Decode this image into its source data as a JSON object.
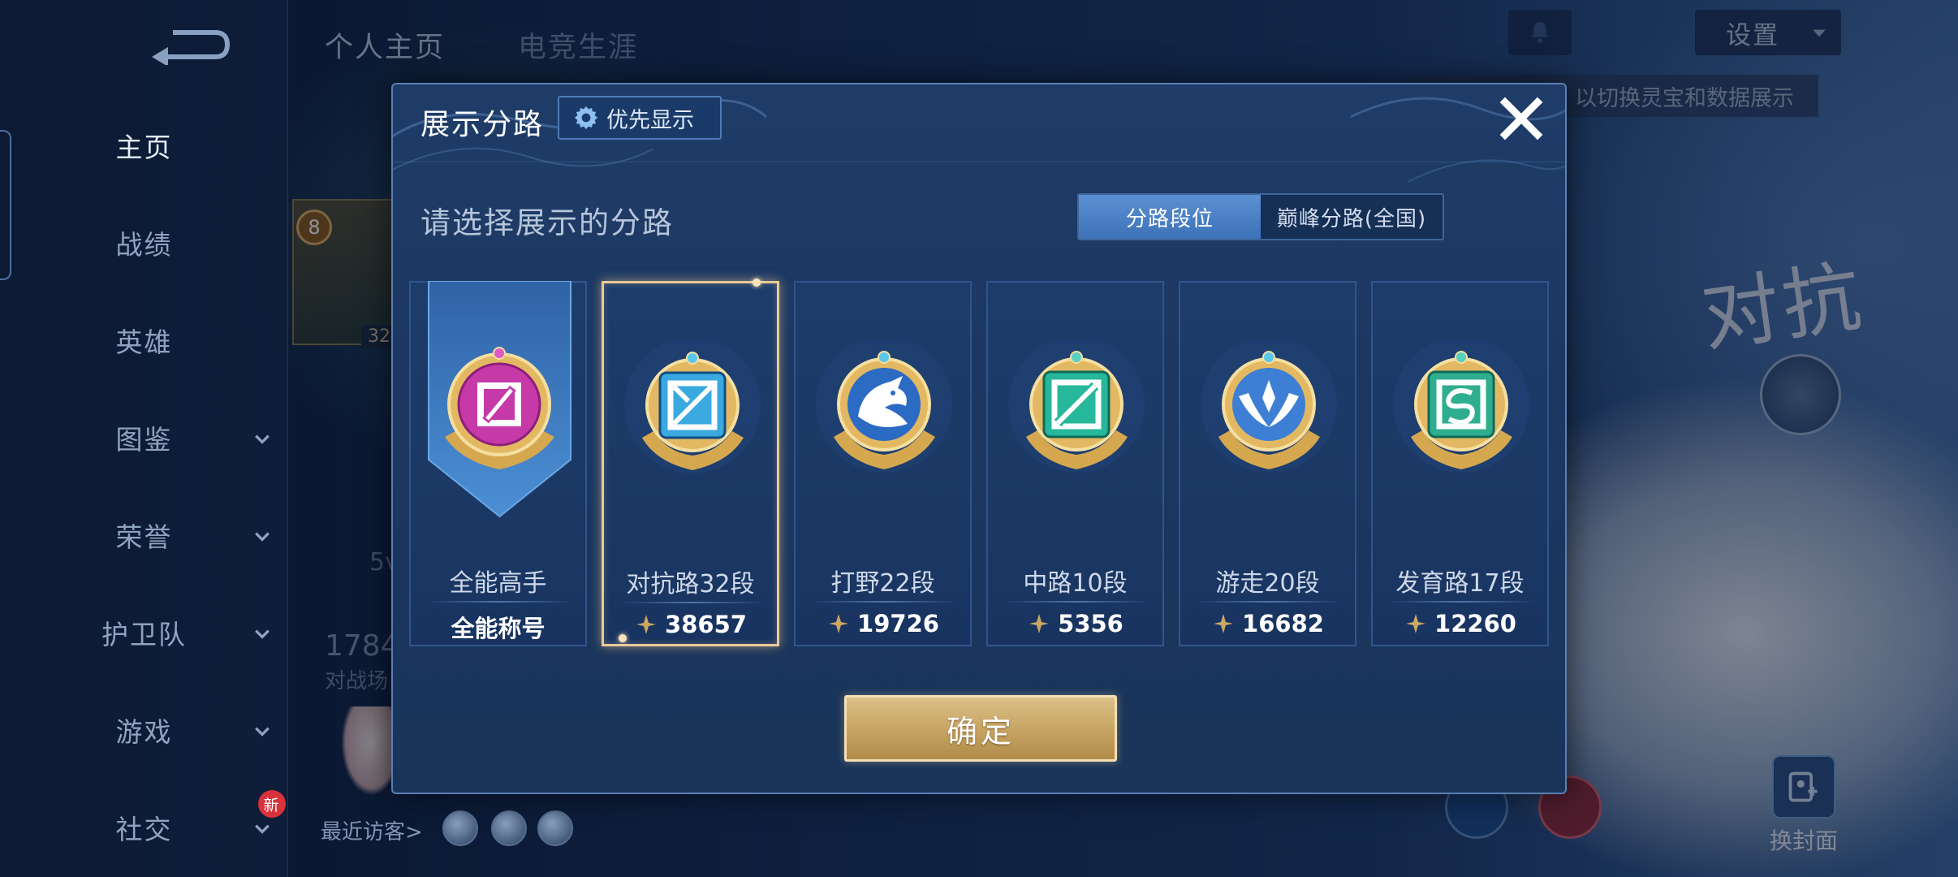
{
  "sidebar": {
    "items": [
      {
        "label": "主页",
        "active": true
      },
      {
        "label": "战绩"
      },
      {
        "label": "英雄"
      },
      {
        "label": "图鉴",
        "expandable": true
      },
      {
        "label": "荣誉",
        "expandable": true
      },
      {
        "label": "护卫队",
        "expandable": true
      },
      {
        "label": "游戏",
        "expandable": true
      },
      {
        "label": "社交",
        "expandable": true,
        "badge": "新"
      }
    ]
  },
  "header": {
    "tabs": [
      {
        "label": "个人主页"
      },
      {
        "label": "电竞生涯"
      }
    ],
    "settings_label": "设置",
    "hint_text": "以切换灵宝和数据展示"
  },
  "background": {
    "mode_text": "对抗",
    "change_cover_label": "换封面",
    "visitors_label": "最近访客>",
    "stat_number": "1784",
    "stat_label": "对战场",
    "mode_5v": "5v",
    "level": "8",
    "card_num": "32"
  },
  "modal": {
    "title": "展示分路",
    "priority_label": "优先显示",
    "subtitle": "请选择展示的分路",
    "toggle": {
      "options": [
        "分路段位",
        "巅峰分路(全国)"
      ],
      "active_index": 0
    },
    "cards": [
      {
        "name": "全能高手",
        "bottom_label": "全能称号",
        "emblem": "all-round-emblem-icon",
        "color": "#c63aa8"
      },
      {
        "name": "对抗路32段",
        "score": "38657",
        "emblem": "clash-lane-emblem-icon",
        "color": "#3aa9e0",
        "selected": true
      },
      {
        "name": "打野22段",
        "score": "19726",
        "emblem": "jungle-emblem-icon",
        "color": "#2b6bc4"
      },
      {
        "name": "中路10段",
        "score": "5356",
        "emblem": "mid-lane-emblem-icon",
        "color": "#27b79a"
      },
      {
        "name": "游走20段",
        "score": "16682",
        "emblem": "roam-emblem-icon",
        "color": "#3d7fd4"
      },
      {
        "name": "发育路17段",
        "score": "12260",
        "emblem": "farm-lane-emblem-icon",
        "color": "#2fae8f"
      }
    ],
    "confirm_label": "确定"
  },
  "colors": {
    "accent_gold": "#e9c99a",
    "toggle_active": "#4b82c6",
    "modal_bg": "#1c3862"
  }
}
